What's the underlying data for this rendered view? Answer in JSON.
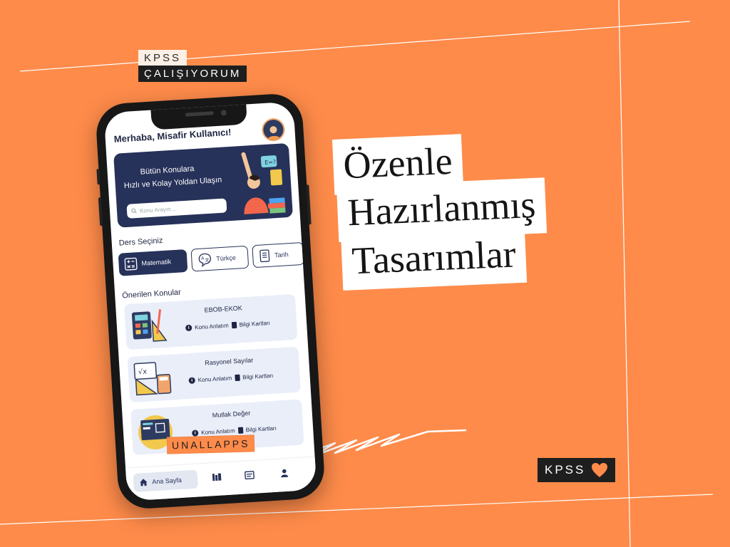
{
  "tags": {
    "kpss": "KPSS",
    "calisiyorum": "ÇALIŞIYORUM",
    "kpss_bottom": "KPSS",
    "brand": "UNALLAPPS"
  },
  "headline": [
    "Özenle",
    "Hazırlanmış",
    "Tasarımlar"
  ],
  "app": {
    "greeting": "Merhaba, Misafir Kullanıcı!",
    "banner": {
      "line1": "Bütün Konulara",
      "line2": "Hızlı ve Kolay Yoldan Ulaşın",
      "search_placeholder": "Konu Arayın..."
    },
    "section_lessons": "Ders Seçiniz",
    "lessons": [
      {
        "label": "Matematik",
        "icon": "math-icon"
      },
      {
        "label": "Türkçe",
        "icon": "language-icon"
      },
      {
        "label": "Tarih",
        "icon": "document-icon"
      }
    ],
    "section_topics": "Önerilen Konular",
    "topics": [
      {
        "title": "EBOB-EKOK",
        "lecture": "Konu Anlatım",
        "cards": "Bilgi Kartları"
      },
      {
        "title": "Rasyonel Sayılar",
        "lecture": "Konu Anlatım",
        "cards": "Bilgi Kartları"
      },
      {
        "title": "Mutlak Değer",
        "lecture": "Konu Anlatım",
        "cards": "Bilgi Kartları"
      }
    ],
    "nav": {
      "home": "Ana Sayfa"
    }
  },
  "colors": {
    "background": "#FE8B4A",
    "navy": "#27325A",
    "card": "#E9EEF9"
  }
}
